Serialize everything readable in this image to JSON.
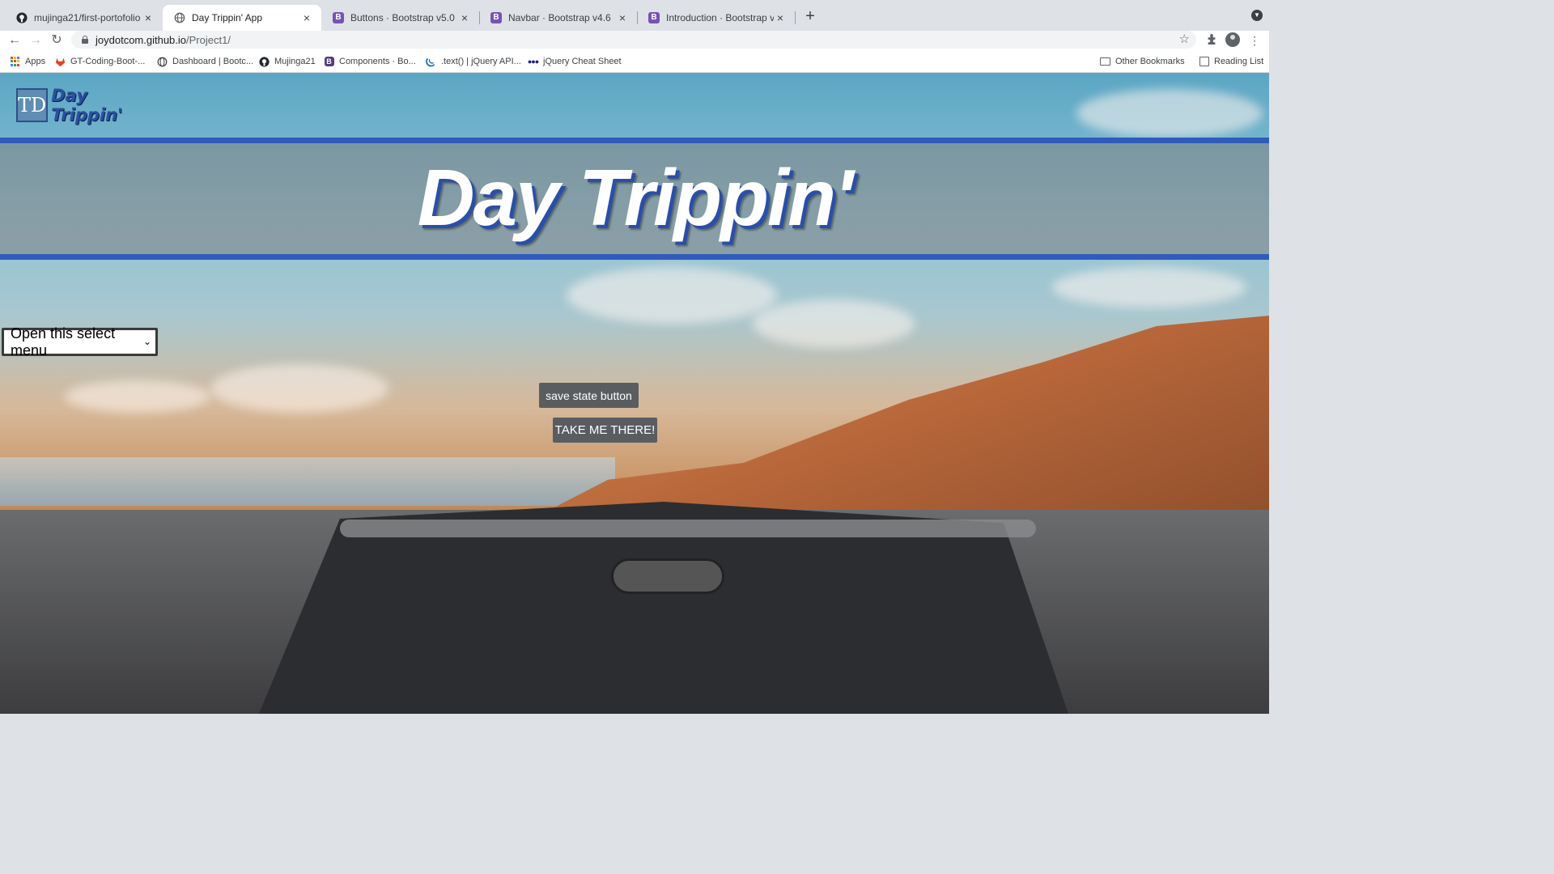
{
  "browser": {
    "tabs": [
      {
        "title": "mujinga21/first-portofolio",
        "icon": "github-icon",
        "active": false
      },
      {
        "title": "Day Trippin' App",
        "icon": "globe-icon",
        "active": true
      },
      {
        "title": "Buttons · Bootstrap v5.0",
        "icon": "bootstrap-icon",
        "active": false
      },
      {
        "title": "Navbar · Bootstrap v4.6",
        "icon": "bootstrap-icon",
        "active": false
      },
      {
        "title": "Introduction · Bootstrap v4.6",
        "icon": "bootstrap-icon",
        "active": false
      }
    ],
    "tab_close_glyph": "×",
    "new_tab_glyph": "+",
    "url_host": "joydotcom.github.io",
    "url_path": "/Project1/",
    "bookmarks": [
      {
        "label": "Apps",
        "icon": "apps-grid-icon"
      },
      {
        "label": "GT-Coding-Boot-...",
        "icon": "gitlab-icon"
      },
      {
        "label": "Dashboard | Bootc...",
        "icon": "globe-icon"
      },
      {
        "label": "Mujinga21",
        "icon": "github-icon"
      },
      {
        "label": "Components · Bo...",
        "icon": "bootstrap-icon"
      },
      {
        "label": ".text() | jQuery API...",
        "icon": "jquery-icon"
      },
      {
        "label": "jQuery Cheat Sheet",
        "icon": "dots-icon"
      }
    ],
    "other_bookmarks": "Other Bookmarks",
    "reading_list": "Reading List"
  },
  "page": {
    "logo_mark": "TD",
    "logo_text": "Day Trippin'",
    "hero_title": "Day Trippin'",
    "select_value": "Open this select menu",
    "save_button": "save state button",
    "go_button": "TAKE ME THERE!"
  },
  "colors": {
    "accent_blue": "#2f5cbc",
    "button_gray": "#5a5d60"
  }
}
